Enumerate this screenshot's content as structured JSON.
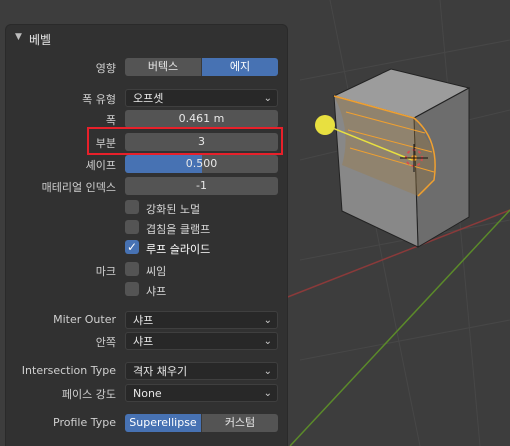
{
  "panel": {
    "title": "베벨",
    "affect": {
      "label": "영향",
      "options": [
        "버텍스",
        "에지"
      ],
      "selected_index": 1
    },
    "width_type": {
      "label": "폭 유형",
      "value": "오프셋"
    },
    "width": {
      "label": "폭",
      "value": "0.461 m"
    },
    "segments": {
      "label": "부분",
      "value": "3"
    },
    "shape": {
      "label": "셰이프",
      "value": "0.500",
      "fraction": 0.5
    },
    "material_index": {
      "label": "매테리얼 인덱스",
      "value": "-1"
    },
    "harden_normals": {
      "label": "강화된 노멀",
      "checked": false
    },
    "clamp_overlap": {
      "label": "겹침을 클램프",
      "checked": false
    },
    "loop_slide": {
      "label": "루프 슬라이드",
      "checked": true
    },
    "mark": {
      "label": "마크",
      "seam": {
        "label": "씨임",
        "checked": false
      },
      "sharp": {
        "label": "샤프",
        "checked": false
      }
    },
    "miter_outer": {
      "label": "Miter Outer",
      "value": "샤프"
    },
    "inner": {
      "label": "안쪽",
      "value": "샤프"
    },
    "intersection_type": {
      "label": "Intersection Type",
      "value": "격자 채우기"
    },
    "face_strength": {
      "label": "페이스 강도",
      "value": "None"
    },
    "profile_type": {
      "label": "Profile Type",
      "options": [
        "Superellipse",
        "커스텀"
      ],
      "selected_index": 0
    }
  },
  "colors": {
    "accent": "#4772b3",
    "highlight_box": "#e8202a",
    "selection": "#f0a030"
  }
}
